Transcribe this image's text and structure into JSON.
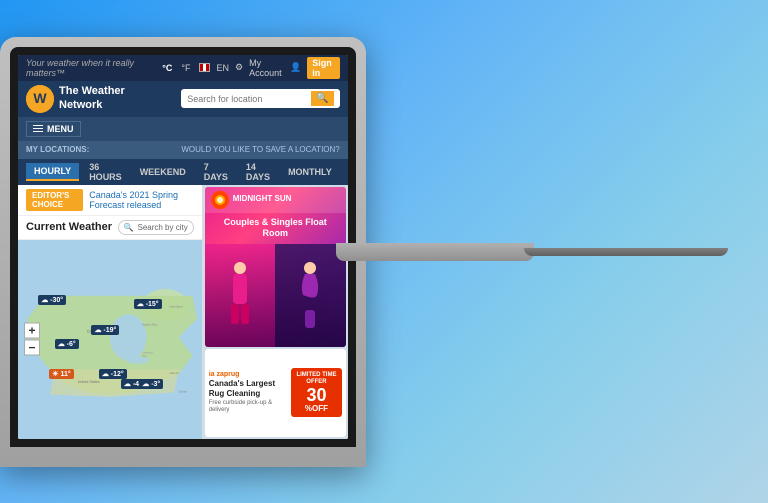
{
  "topbar": {
    "tagline": "Your weather when it really matters™",
    "temp_c": "°C",
    "temp_f": "°F",
    "language": "EN",
    "my_account": "My Account",
    "sign_in": "Sign in"
  },
  "header": {
    "logo_letter": "W",
    "brand_line1": "The Weather",
    "brand_line2": "Network",
    "search_placeholder": "Search for location"
  },
  "navbar": {
    "menu_label": "MENU"
  },
  "location_bar": {
    "my_locations_label": "MY LOCATIONS:",
    "save_prompt": "WOULD YOU LIKE TO SAVE A LOCATION?"
  },
  "nav_tabs": {
    "tabs": [
      {
        "label": "HOURLY",
        "active": true
      },
      {
        "label": "36 HOURS",
        "active": false
      },
      {
        "label": "WEEKEND",
        "active": false
      },
      {
        "label": "7 DAYS",
        "active": false
      },
      {
        "label": "14 DAYS",
        "active": false
      },
      {
        "label": "MONTHLY",
        "active": false
      }
    ]
  },
  "editors_choice": {
    "badge": "EDITOR'S CHOICE",
    "link_text": "Canada's 2021 Spring Forecast released"
  },
  "map": {
    "title": "Current Weather",
    "search_placeholder": "Search by city"
  },
  "zoom": {
    "plus": "+",
    "minus": "−"
  },
  "weather_markers": [
    {
      "temp": "-30°",
      "icon": "☁",
      "top": "30%",
      "left": "12%"
    },
    {
      "temp": "-6°",
      "icon": "☁",
      "top": "52%",
      "left": "22%"
    },
    {
      "temp": "-19°",
      "icon": "☁",
      "top": "45%",
      "left": "42%"
    },
    {
      "temp": "-15°",
      "icon": "☁",
      "top": "32%",
      "left": "68%"
    },
    {
      "temp": "11°",
      "icon": "☀",
      "top": "68%",
      "left": "20%"
    },
    {
      "temp": "-12°",
      "icon": "☁",
      "top": "68%",
      "left": "47%"
    },
    {
      "temp": "-3°",
      "icon": "☁",
      "top": "72%",
      "left": "70%"
    },
    {
      "temp": "-4°",
      "icon": "☁",
      "top": "75%",
      "left": "60%"
    }
  ],
  "ads": {
    "midnight_sun": {
      "title": "MIDNIGHT SUN",
      "subtitle": "Couples & Singles Float Room",
      "person1": "🧍",
      "person2": "🧘"
    },
    "rug": {
      "logo": "ia zaprug",
      "title": "Canada's Largest Rug Cleaning",
      "subtitle": "Free curbside pick-up & delivery",
      "offer_line1": "LIMITED TIME OFFER",
      "percent": "30",
      "off": "%OFF"
    }
  },
  "colors": {
    "brand_orange": "#f5a623",
    "dark_navy": "#1e3a5f",
    "medium_navy": "#2c4a6e",
    "tab_blue": "#2c6fad",
    "pink_gradient_start": "#e91e8c",
    "pink_gradient_end": "#9c27b0",
    "red_offer": "#e63000"
  }
}
